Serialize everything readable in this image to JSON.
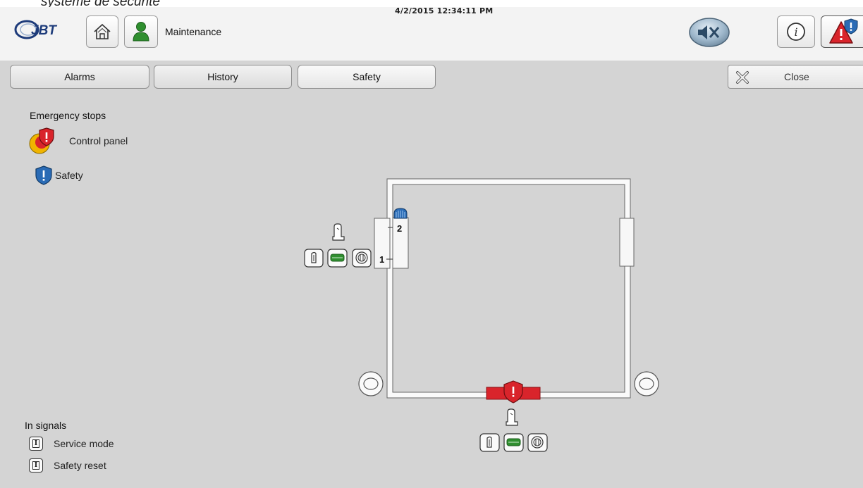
{
  "caption": "systeme de sécurité",
  "header": {
    "datetime": "4/2/2015 12:34:11 PM",
    "title": "Maintenance",
    "logo_text": "JBT"
  },
  "tabs": [
    {
      "label": "Alarms",
      "active": false
    },
    {
      "label": "History",
      "active": false
    },
    {
      "label": "Safety",
      "active": true
    }
  ],
  "close_label": "Close",
  "emergency": {
    "title": "Emergency stops",
    "items": [
      {
        "label": "Control panel",
        "icon": "control-panel-estop-icon"
      },
      {
        "label": "Safety",
        "icon": "safety-shield-icon"
      }
    ]
  },
  "diagram": {
    "door_labels": [
      "2",
      "1"
    ]
  },
  "signals": {
    "title": "In signals",
    "items": [
      {
        "label": "Service mode",
        "icon": "input-signal-icon"
      },
      {
        "label": "Safety reset",
        "icon": "input-signal-icon"
      }
    ]
  },
  "colors": {
    "accent_red": "#d9242b",
    "accent_blue": "#2a6bb5",
    "accent_green": "#2f8f2f",
    "panel_bg": "#d4d4d4"
  }
}
